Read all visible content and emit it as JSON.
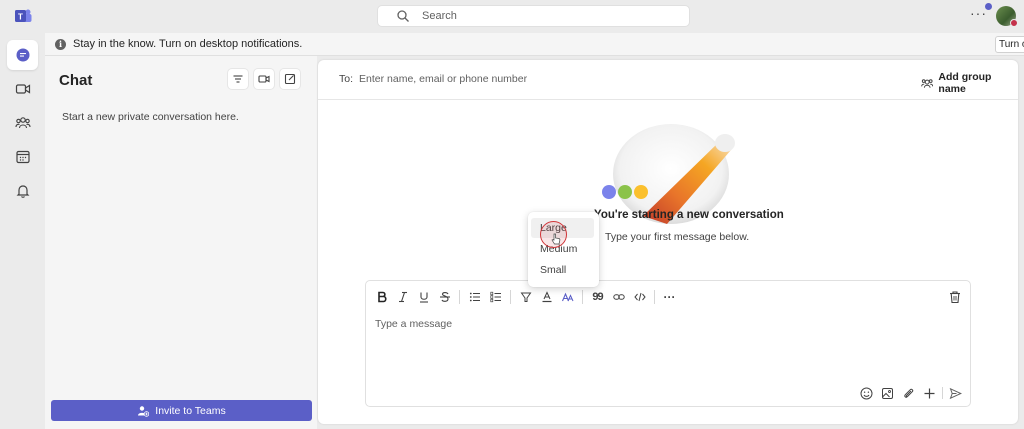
{
  "app": {
    "search_placeholder": "Search",
    "more_label": "···"
  },
  "rail": {
    "items": [
      "chat-icon",
      "video-icon",
      "people-icon",
      "calendar-icon",
      "bell-icon"
    ]
  },
  "notification": {
    "info_glyph": "i",
    "message": "Stay in the know. Turn on desktop notifications.",
    "button": "Turn on"
  },
  "chat_panel": {
    "title": "Chat",
    "empty_text": "Start a new private conversation here.",
    "invite_button": "Invite to Teams"
  },
  "new_chat": {
    "to_label": "To:",
    "to_placeholder": "Enter name, email or phone number",
    "add_group_name": "Add group name",
    "heading": "You're starting a new conversation",
    "subheading": "Type your first message below."
  },
  "compose": {
    "placeholder": "Type a message",
    "quote_glyph": "99",
    "more_glyph": "···"
  },
  "font_size_menu": {
    "options": [
      "Large",
      "Medium",
      "Small"
    ],
    "hovered": "Large"
  },
  "colors": {
    "brand": "#5b5fc7",
    "accent_red": "#d13438"
  }
}
